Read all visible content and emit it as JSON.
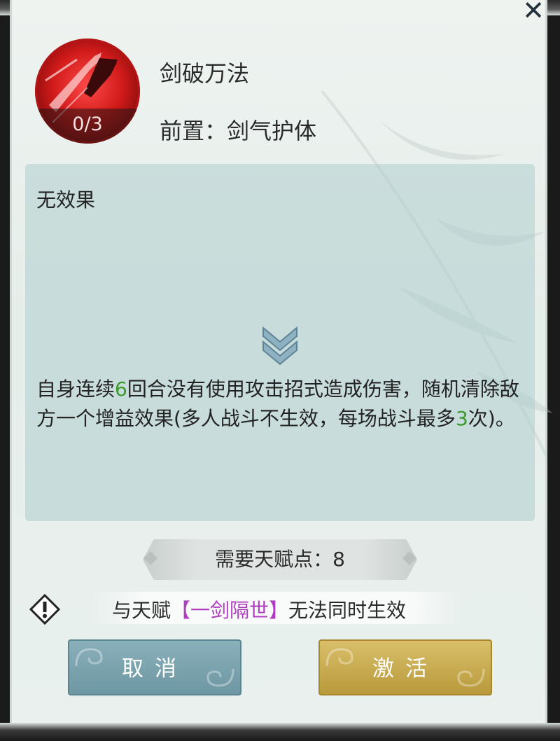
{
  "header": {
    "close_icon": "close-icon"
  },
  "skill": {
    "name": "剑破万法",
    "level": "0/3",
    "prerequisite": "前置：剑气护体",
    "icon": "sword-skill-icon"
  },
  "effects": {
    "current": "无效果",
    "next_parts": [
      "自身连续",
      "6",
      "回合没有使用攻击招式造成伤害，随机清除敌方一个增益效果(多人战斗不生效，每场战斗最多",
      "3",
      "次)。"
    ],
    "expand_icon": "double-chevron-down-icon"
  },
  "talent_cost": {
    "label": "需要天赋点：8"
  },
  "conflict": {
    "icon": "warning-icon",
    "prefix": "与天赋",
    "talent": "【一剑隔世】",
    "suffix": "无法同时生效"
  },
  "buttons": {
    "cancel": "取消",
    "activate": "激活"
  },
  "colors": {
    "highlight_number": "#3a9a2a",
    "conflict_talent": "#b03cc0"
  }
}
